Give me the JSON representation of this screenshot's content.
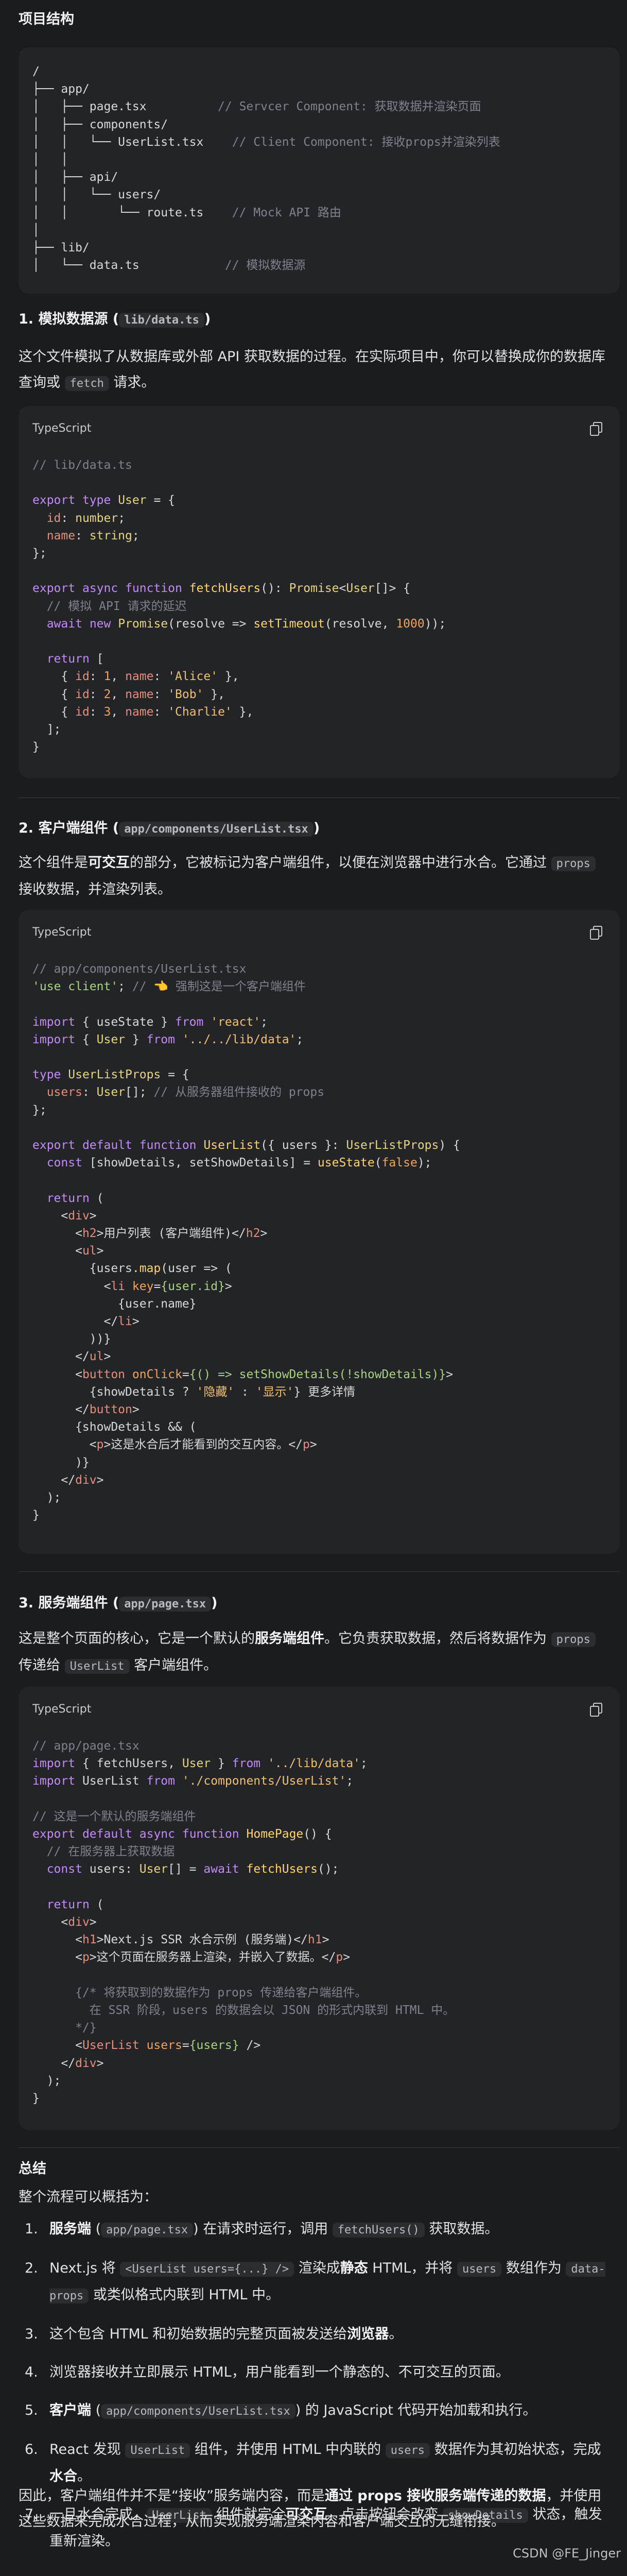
{
  "sections": {
    "structure_title": "项目结构",
    "data_title": "1. 模拟数据源 (",
    "data_title_code": "lib/data.ts",
    "data_title_end": ")",
    "data_desc_1": "这个文件模拟了从数据库或外部 API 获取数据的过程。在实际项目中，你可以替换成你的数据库查询或",
    "data_desc_code": "fetch",
    "data_desc_2": "请求。",
    "client_title": "2. 客户端组件 (",
    "client_title_code": "app/components/UserList.tsx",
    "client_title_end": ")",
    "client_desc_1": "这个组件是",
    "client_desc_b": "可交互",
    "client_desc_2": "的部分，它被标记为客户端组件，以便在浏览器中进行水合。它通过",
    "client_desc_code": "props",
    "client_desc_3": "接收数据，并渲染列表。",
    "server_title": "3. 服务端组件 (",
    "server_title_code": "app/page.tsx",
    "server_title_end": ")",
    "server_desc_1": "这是整个页面的核心，它是一个默认的",
    "server_desc_b": "服务端组件",
    "server_desc_2": "。它负责获取数据，然后将数据作为",
    "server_desc_code": "props",
    "server_desc_3": "传递给",
    "server_desc_code2": "UserList",
    "server_desc_4": "客户端组件。",
    "summary_title": "总结",
    "summary_intro": "整个流程可以概括为：",
    "conclusion_1": "因此，客户端组件并不是“接收”服务端内容，而是",
    "conclusion_b": "通过 props 接收服务端传递的数据",
    "conclusion_2": "，并使用这些数据来完成水合过程，从而实现服务端渲染内容和客户端交互的无缝衔接。"
  },
  "code_lang": "TypeScript",
  "steps": [
    {
      "num": "1.",
      "html": "<b>服务端</b> (<span class=\"ic\">app/page.tsx</span>) 在请求时运行，调用 <span class=\"ic\">fetchUsers()</span> 获取数据。"
    },
    {
      "num": "2.",
      "html": "Next.js 将 <span class=\"ic\">&lt;UserList users={...} /&gt;</span> 渲染成<b>静态</b> HTML，并将 <span class=\"ic\">users</span> 数组作为 <span class=\"ic\">data-props</span> 或类似格式内联到 HTML 中。"
    },
    {
      "num": "3.",
      "html": "这个包含 HTML 和初始数据的完整页面被发送给<b>浏览器</b>。"
    },
    {
      "num": "4.",
      "html": "浏览器接收并立即展示 HTML，用户能看到一个静态的、不可交互的页面。"
    },
    {
      "num": "5.",
      "html": "<b>客户端</b> (<span class=\"ic\">app/components/UserList.tsx</span>) 的 JavaScript 代码开始加载和执行。"
    },
    {
      "num": "6.",
      "html": "React 发现 <span class=\"ic\">UserList</span> 组件，并使用 HTML 中内联的 <span class=\"ic\">users</span> 数据作为其初始状态，完成<b>水合</b>。"
    },
    {
      "num": "7.",
      "html": "一旦水合完成，<span class=\"ic\">UserList</span> 组件就完全<b>可交互</b>，点击按钮会改变 <span class=\"ic\">showDetails</span> 状态，触发重新渲染。"
    }
  ],
  "watermark": "CSDN @FE_Jinger"
}
